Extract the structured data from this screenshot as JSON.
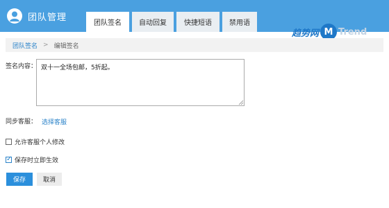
{
  "header": {
    "title": "团队管理",
    "icon": "user-icon",
    "colors": {
      "bar": "#4aa0e0",
      "active_tab": "#ffffff",
      "tab": "#e9eef2"
    }
  },
  "tabs": [
    {
      "label": "团队签名",
      "active": true
    },
    {
      "label": "自动回复",
      "active": false
    },
    {
      "label": "快捷短语",
      "active": false
    },
    {
      "label": "禁用语",
      "active": false
    }
  ],
  "watermark": {
    "text_left": "趋势网",
    "badge": "M",
    "text_right": "Trend"
  },
  "breadcrumb": {
    "parent": "团队签名",
    "separator": ">",
    "current": "编辑签名"
  },
  "form": {
    "signature_label": "签名内容：",
    "signature_value": "双十一全场包邮，5折起。",
    "sync_label": "同步客服：",
    "select_link": "选择客服",
    "allow_edit_label": "允许客服个人修改",
    "allow_edit_checked": false,
    "effective_label": "保存时立即生效",
    "effective_checked": true
  },
  "buttons": {
    "save": "保存",
    "cancel": "取消"
  }
}
